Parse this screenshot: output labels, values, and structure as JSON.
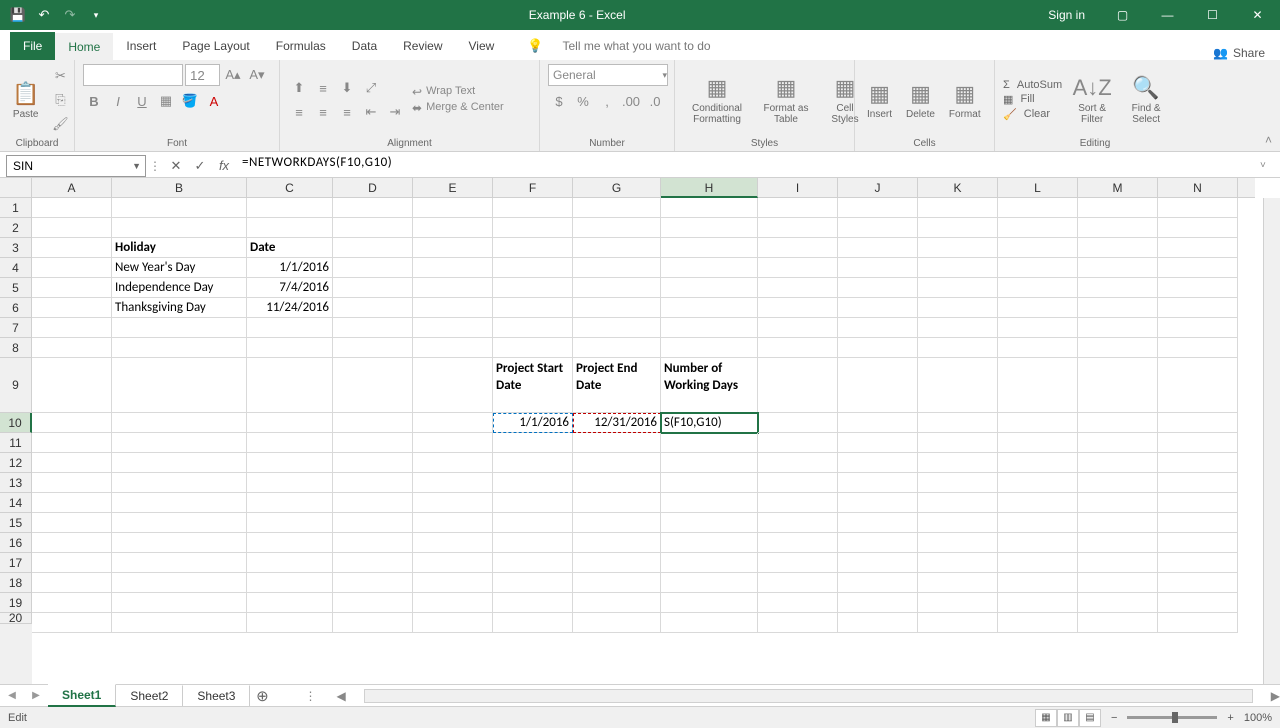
{
  "title": "Example 6 - Excel",
  "signin": "Sign in",
  "share": "Share",
  "tabs": [
    "File",
    "Home",
    "Insert",
    "Page Layout",
    "Formulas",
    "Data",
    "Review",
    "View"
  ],
  "tellme": "Tell me what you want to do",
  "ribbon": {
    "clipboard": {
      "paste": "Paste",
      "label": "Clipboard"
    },
    "font": {
      "size": "12",
      "label": "Font"
    },
    "alignment": {
      "wrap": "Wrap Text",
      "merge": "Merge & Center",
      "label": "Alignment"
    },
    "number": {
      "format": "General",
      "label": "Number"
    },
    "styles": {
      "cond": "Conditional Formatting",
      "fmtTable": "Format as Table",
      "cellStyles": "Cell Styles",
      "label": "Styles"
    },
    "cells": {
      "insert": "Insert",
      "delete": "Delete",
      "format": "Format",
      "label": "Cells"
    },
    "editing": {
      "autosum": "AutoSum",
      "fill": "Fill",
      "clear": "Clear",
      "sort": "Sort & Filter",
      "find": "Find & Select",
      "label": "Editing"
    }
  },
  "name_box": "SIN",
  "formula": "=NETWORKDAYS(F10,G10)",
  "columns": [
    "A",
    "B",
    "C",
    "D",
    "E",
    "F",
    "G",
    "H",
    "I",
    "J",
    "K",
    "L",
    "M",
    "N"
  ],
  "cells": {
    "B3": "Holiday",
    "C3": "Date",
    "B4": "New Year's Day",
    "C4": "1/1/2016",
    "B5": "Independence Day",
    "C5": "7/4/2016",
    "B6": "Thanksgiving Day",
    "C6": "11/24/2016",
    "F9": "Project Start Date",
    "G9": "Project End Date",
    "H9": "Number of Working Days",
    "F10": "1/1/2016",
    "G10": "12/31/2016",
    "H10": "S(F10,G10)"
  },
  "sheets": [
    "Sheet1",
    "Sheet2",
    "Sheet3"
  ],
  "status": "Edit",
  "zoom": "100%"
}
